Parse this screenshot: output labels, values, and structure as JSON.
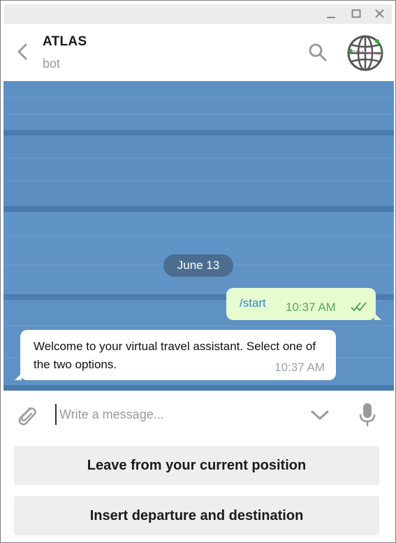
{
  "header": {
    "title": "ATLAS",
    "subtitle": "bot"
  },
  "chat": {
    "date_label": "June 13",
    "messages": [
      {
        "direction": "outgoing",
        "text": "/start",
        "time": "10:37 AM",
        "status": "read"
      },
      {
        "direction": "incoming",
        "text": "Welcome to your virtual travel assistant. Select one of the two options.",
        "time": "10:37 AM"
      }
    ]
  },
  "composer": {
    "placeholder": "Write a message..."
  },
  "keyboard": {
    "buttons": [
      "Leave from your current position",
      "Insert departure and destination"
    ]
  },
  "colors": {
    "chat_background": "#5b8dc0",
    "outgoing_bubble": "#e6fbcf",
    "incoming_bubble": "#ffffff",
    "link_blue": "#2e8bc6",
    "read_green": "#5aa65a",
    "keyboard_button": "#eeeeee"
  },
  "icons": {
    "back": "chevron-left-icon",
    "search": "search-icon",
    "avatar": "globe-icon",
    "attach": "paperclip-icon",
    "chevron": "chevron-down-icon",
    "mic": "microphone-icon",
    "read": "double-check-icon"
  }
}
